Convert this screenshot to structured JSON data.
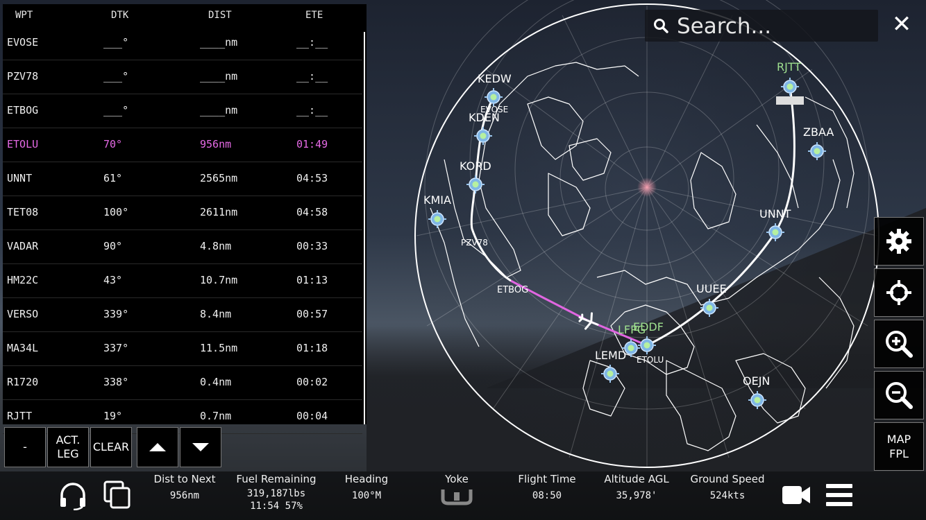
{
  "flight_plan": {
    "headers": {
      "wpt": "WPT",
      "dtk": "DTK",
      "dist": "DIST",
      "ete": "ETE"
    },
    "rows": [
      {
        "wpt": "EVOSE",
        "dtk": "___°",
        "dist": "____nm",
        "ete": "__:__",
        "active": false
      },
      {
        "wpt": "PZV78",
        "dtk": "___°",
        "dist": "____nm",
        "ete": "__:__",
        "active": false
      },
      {
        "wpt": "ETBOG",
        "dtk": "___°",
        "dist": "____nm",
        "ete": "__:__",
        "active": false
      },
      {
        "wpt": "ETOLU",
        "dtk": "70°",
        "dist": "956nm",
        "ete": "01:49",
        "active": true
      },
      {
        "wpt": "UNNT",
        "dtk": "61°",
        "dist": "2565nm",
        "ete": "04:53",
        "active": false
      },
      {
        "wpt": "TET08",
        "dtk": "100°",
        "dist": "2611nm",
        "ete": "04:58",
        "active": false
      },
      {
        "wpt": "VADAR",
        "dtk": "90°",
        "dist": "4.8nm",
        "ete": "00:33",
        "active": false
      },
      {
        "wpt": "HM22C",
        "dtk": "43°",
        "dist": "10.7nm",
        "ete": "01:13",
        "active": false
      },
      {
        "wpt": "VERSO",
        "dtk": "339°",
        "dist": "8.4nm",
        "ete": "00:57",
        "active": false
      },
      {
        "wpt": "MA34L",
        "dtk": "337°",
        "dist": "11.5nm",
        "ete": "01:18",
        "active": false
      },
      {
        "wpt": "R1720",
        "dtk": "338°",
        "dist": "0.4nm",
        "ete": "00:02",
        "active": false
      },
      {
        "wpt": "RJTT",
        "dtk": "19°",
        "dist": "0.7nm",
        "ete": "00:04",
        "active": false
      }
    ],
    "active_color": "#e66ae6",
    "buttons": {
      "minus": "-",
      "act_leg_1": "ACT.",
      "act_leg_2": "LEG",
      "clear": "CLEAR"
    }
  },
  "search": {
    "placeholder": "Search..."
  },
  "map": {
    "airports": [
      {
        "code": "KEDW",
        "color": "#ffffff"
      },
      {
        "code": "KDEN",
        "color": "#ffffff"
      },
      {
        "code": "KORD",
        "color": "#ffffff"
      },
      {
        "code": "KMIA",
        "color": "#ffffff"
      },
      {
        "code": "RJTT",
        "color": "#9fe08f"
      },
      {
        "code": "ZBAA",
        "color": "#ffffff"
      },
      {
        "code": "UNNT",
        "color": "#ffffff"
      },
      {
        "code": "UUEE",
        "color": "#ffffff"
      },
      {
        "code": "LEMD",
        "color": "#ffffff"
      },
      {
        "code": "OEJN",
        "color": "#ffffff"
      },
      {
        "code": "LFPG",
        "color": "#9fe08f"
      },
      {
        "code": "EDDF",
        "color": "#9fe08f"
      }
    ],
    "waypoint_labels": {
      "evose": "EVOSE",
      "pzv78": "PZV78",
      "etbog": "ETBOG",
      "etolu": "ETOLU"
    },
    "route_color": "#ffffff",
    "active_leg_color": "#e066e0"
  },
  "side_buttons": {
    "map_fpl_1": "MAP",
    "map_fpl_2": "FPL"
  },
  "status": {
    "dist_to_next": {
      "label": "Dist to Next",
      "value": "956nm"
    },
    "fuel": {
      "label": "Fuel Remaining",
      "value1": "319,187lbs",
      "value2": "11:54 57%"
    },
    "heading": {
      "label": "Heading",
      "value": "100°M"
    },
    "yoke": {
      "label": "Yoke"
    },
    "flight_time": {
      "label": "Flight Time",
      "value": "08:50"
    },
    "altitude": {
      "label": "Altitude AGL",
      "value": "35,978'"
    },
    "ground_speed": {
      "label": "Ground Speed",
      "value": "524kts"
    }
  }
}
